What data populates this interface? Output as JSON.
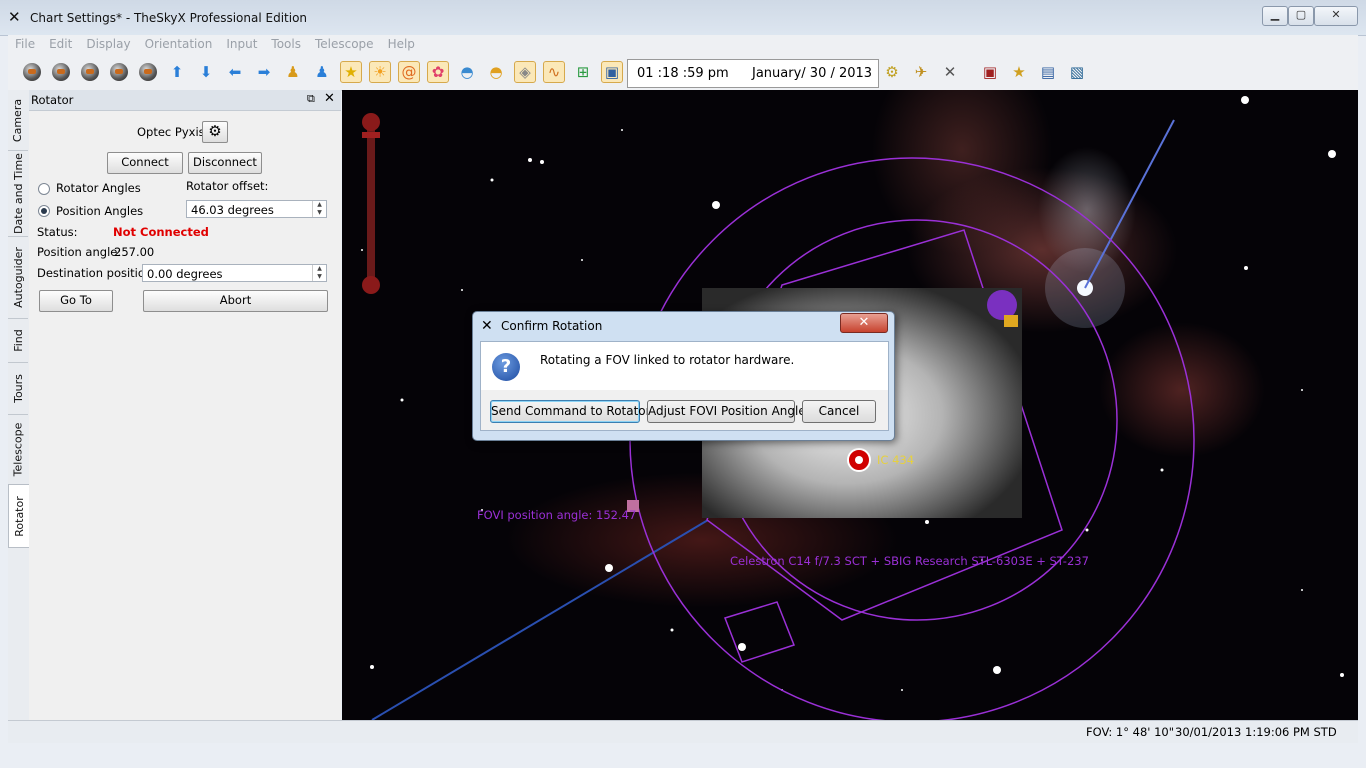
{
  "window": {
    "title": "Chart Settings* - TheSkyX Professional Edition",
    "app_icon": "x-logo-icon"
  },
  "menu": [
    "File",
    "Edit",
    "Display",
    "Orientation",
    "Input",
    "Tools",
    "Telescope",
    "Help"
  ],
  "toolbar": {
    "time": "01 :18 :59  pm",
    "date": "January/ 30 / 2013"
  },
  "side_tabs": [
    "Camera",
    "Date and Time",
    "Autoguider",
    "Find",
    "Tours",
    "Telescope",
    "Rotator"
  ],
  "rotator": {
    "panel_title": "Rotator",
    "device_name": "Optec Pyxis",
    "connect_label": "Connect",
    "disconnect_label": "Disconnect",
    "rotator_angles_label": "Rotator Angles",
    "position_angles_label": "Position Angles",
    "offset_label": "Rotator offset:",
    "offset_value": "46.03 degrees",
    "status_label": "Status:",
    "status_value": "Not Connected",
    "status_color": "#e00000",
    "position_angle_label": "Position angle:",
    "position_angle_value": "257.00",
    "destination_label": "Destination position:",
    "destination_value": "0.00 degrees",
    "goto_label": "Go To",
    "abort_label": "Abort"
  },
  "chart": {
    "fovi_label": "FOVI position angle: 152.47",
    "instrument_label": "Celestron C14 f/7.3 SCT + SBIG Research STL-6303E + ST-237",
    "object_label": "IC 434",
    "fov_color": "#9a30d6"
  },
  "dialog": {
    "title": "Confirm Rotation",
    "message": "Rotating a FOV linked to rotator hardware.",
    "send_label": "Send Command to Rotator",
    "adjust_label": "Adjust FOVI Position Angle",
    "cancel_label": "Cancel"
  },
  "status_bar": {
    "fov": "FOV: 1° 48' 10\"",
    "date": "30/01/2013",
    "time": "1:19:06 PM STD"
  }
}
